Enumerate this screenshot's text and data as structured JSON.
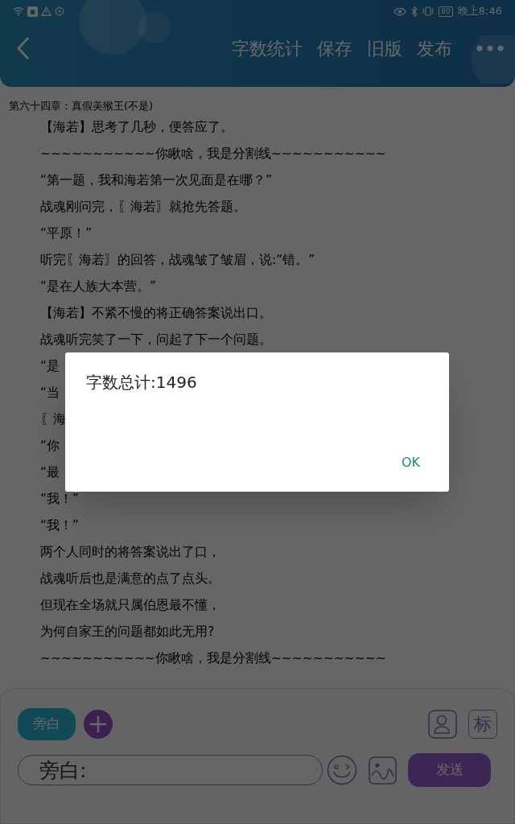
{
  "status_bar": {
    "time": "晚上8:46",
    "battery": "80"
  },
  "toolbar": {
    "actions": [
      "字数统计",
      "保存",
      "旧版",
      "发布"
    ]
  },
  "chapter_title": "第六十四章：真假美猴王(不是)",
  "lines": [
    "【海若】思考了几秒，便答应了。",
    "~~~~~~~~~~~你瞅啥，我是分割线~~~~~~~~~~~",
    "“第一题，我和海若第一次见面是在哪？”",
    "战魂刚问完，〖海若〗就抢先答题。",
    "“平原！”",
    "听完〖海若〗的回答，战魂皱了皱眉，说:“错。”",
    "“是在人族大本营。”",
    "【海若】不紧不慢的将正确答案说出口。",
    "战魂听完笑了一下，问起了下一个问题。",
    "“是",
    "“当",
    "〖海",
    "“你",
    "“最",
    "“我！”",
    "“我！”",
    "两个人同时的将答案说出了口，",
    "战魂听后也是满意的点了点头。",
    "但现在全场就只属伯恩最不懂，",
    "为何自家王的问题都如此无用?",
    "~~~~~~~~~~~你瞅啥，我是分割线~~~~~~~~~~~"
  ],
  "composer": {
    "role_chip": "旁白",
    "input": {
      "placeholder": "旁白:"
    },
    "tag_button": "标",
    "send_button": "发送"
  },
  "dialog": {
    "message": "字数总计:1496",
    "button": "OK"
  }
}
